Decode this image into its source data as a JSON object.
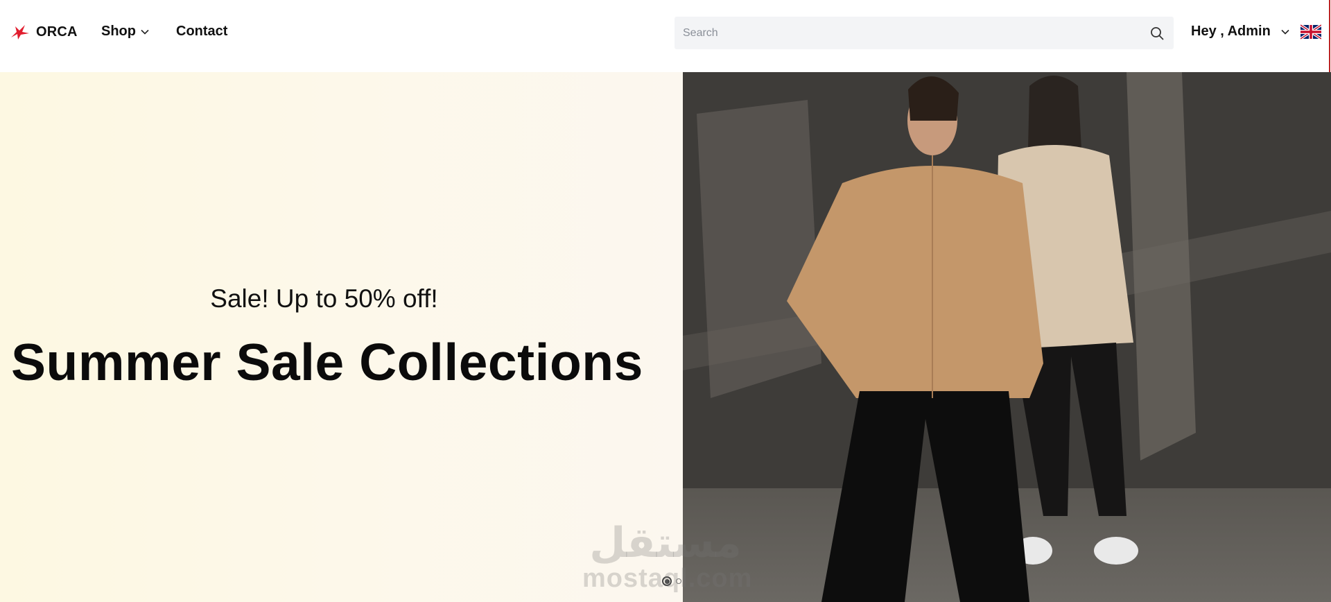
{
  "header": {
    "logo_text": "ORCA",
    "nav": [
      {
        "label": "Shop",
        "has_dropdown": true
      },
      {
        "label": "Contact",
        "has_dropdown": false
      }
    ],
    "search": {
      "placeholder": "Search",
      "value": ""
    },
    "user": {
      "greeting": "Hey , Admin",
      "has_dropdown": true
    },
    "language": {
      "icon": "uk-flag-icon"
    }
  },
  "hero": {
    "subtitle": "Sale! Up to 50% off!",
    "title": "Summer Sale Collections",
    "slides": {
      "count": 2,
      "active_index": 0
    }
  },
  "watermark": {
    "arabic": "مستقل",
    "latin": "mostaql.com"
  },
  "colors": {
    "accent": "#e11d2e",
    "hero_bg": "#fdf8e8",
    "search_bg": "#f3f4f6",
    "text": "#111111"
  },
  "icons": {
    "logo": "orca-logo-icon",
    "search": "search-icon",
    "dropdown": "chevron-down-icon"
  }
}
